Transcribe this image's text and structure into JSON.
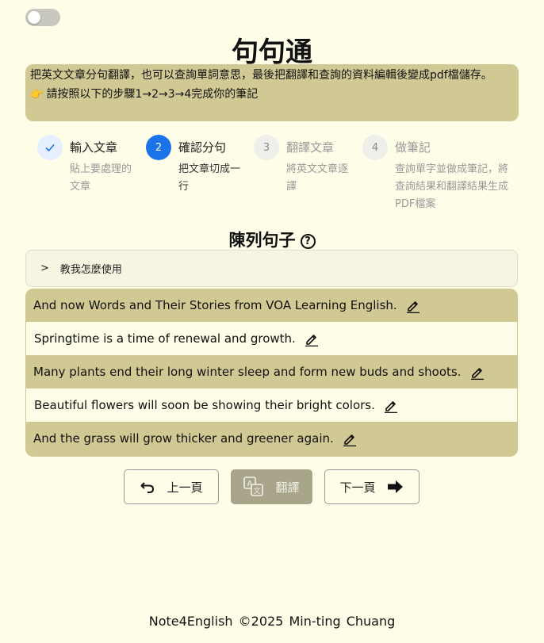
{
  "app": {
    "title": "句句通"
  },
  "intro": {
    "line1": "把英文文章分句翻譯，也可以查詢單詞意思，最後把翻譯和查詢的資料編輯後變成pdf檔儲存。",
    "hint": "請按照以下的步驟1→2→3→4完成你的筆記"
  },
  "steps": [
    {
      "num": "✓",
      "title": "輸入文章",
      "desc": "貼上要處理的文章",
      "status": "done"
    },
    {
      "num": "2",
      "title": "確認分句",
      "desc": "把文章切成一行",
      "status": "active"
    },
    {
      "num": "3",
      "title": "翻譯文章",
      "desc": "將英文文章逐譯",
      "status": "wait"
    },
    {
      "num": "4",
      "title": "做筆記",
      "desc": "查詢單字並做成筆記，將查詢結果和翻譯結果生成PDF檔案",
      "status": "wait"
    }
  ],
  "section": {
    "title": "陳列句子",
    "help_icon": "?"
  },
  "tutorial": {
    "label": "教我怎麼使用",
    "chevron": ">"
  },
  "sentences": [
    "And now Words and Their Stories from VOA Learning English.",
    "Springtime is a time of renewal and growth.",
    "Many plants end their long winter sleep and form new buds and shoots.",
    "Beautiful flowers will soon be showing their bright colors.",
    "And the grass will grow thicker and greener again."
  ],
  "buttons": {
    "prev": "上一頁",
    "translate": "翻譯",
    "next": "下一頁"
  },
  "footer": {
    "text": "Note4English  ©2025  Min-ting Chuang"
  },
  "colors": {
    "accent": "#1a73e8",
    "band": "#d1c994",
    "background": "#fefde8"
  }
}
